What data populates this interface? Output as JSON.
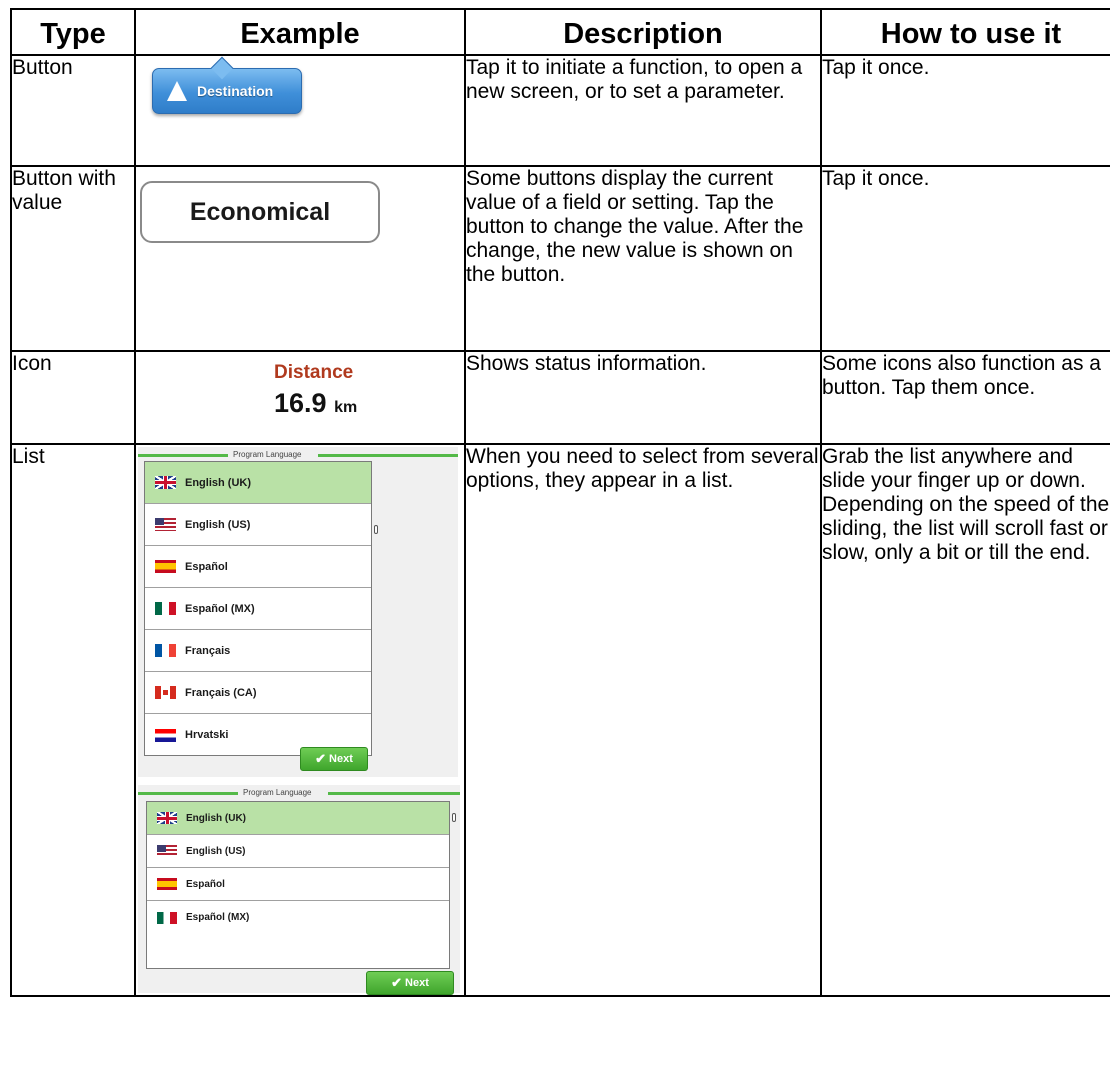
{
  "headers": {
    "type": "Type",
    "example": "Example",
    "description": "Description",
    "how": "How to use it"
  },
  "rows": [
    {
      "type": "Button",
      "description": "Tap it to initiate a function, to open a new screen, or to set a parameter.",
      "how": "Tap it once.",
      "example": {
        "label": "Destination",
        "icon": "arrow-up-icon",
        "color": "#3f8fd9"
      }
    },
    {
      "type": "Button with value",
      "description": "Some buttons display the current value of a field or setting. Tap the button to change the value. After the change, the new value is shown on the button.",
      "how": "Tap it once.",
      "example": {
        "label": "Economical"
      }
    },
    {
      "type": "Icon",
      "description": "Shows status information.",
      "how": "Some icons also function as a button. Tap them once.",
      "example": {
        "label": "Distance",
        "value": "16.9",
        "unit": "km",
        "label_color": "#b03a1e"
      }
    },
    {
      "type": "List",
      "description": "When you need to select from several options, they appear in a list.",
      "how": "Grab the list anywhere and slide your finger up or down. Depending on the speed of the sliding, the list will scroll fast or slow, only a bit or till the end.",
      "example": {
        "panel1": {
          "title": "Program Language",
          "items": [
            "English (UK)",
            "English (US)",
            "Español",
            "Español (MX)",
            "Français",
            "Français (CA)",
            "Hrvatski"
          ],
          "selected": "English (UK)",
          "next_label": "Next"
        },
        "panel2": {
          "title": "Program Language",
          "items": [
            "English (UK)",
            "English (US)",
            "Español",
            "Español (MX)"
          ],
          "selected": "English (UK)",
          "next_label": "Next"
        },
        "accent_color": "#54b948",
        "selected_color": "#b9e1a6"
      }
    }
  ]
}
